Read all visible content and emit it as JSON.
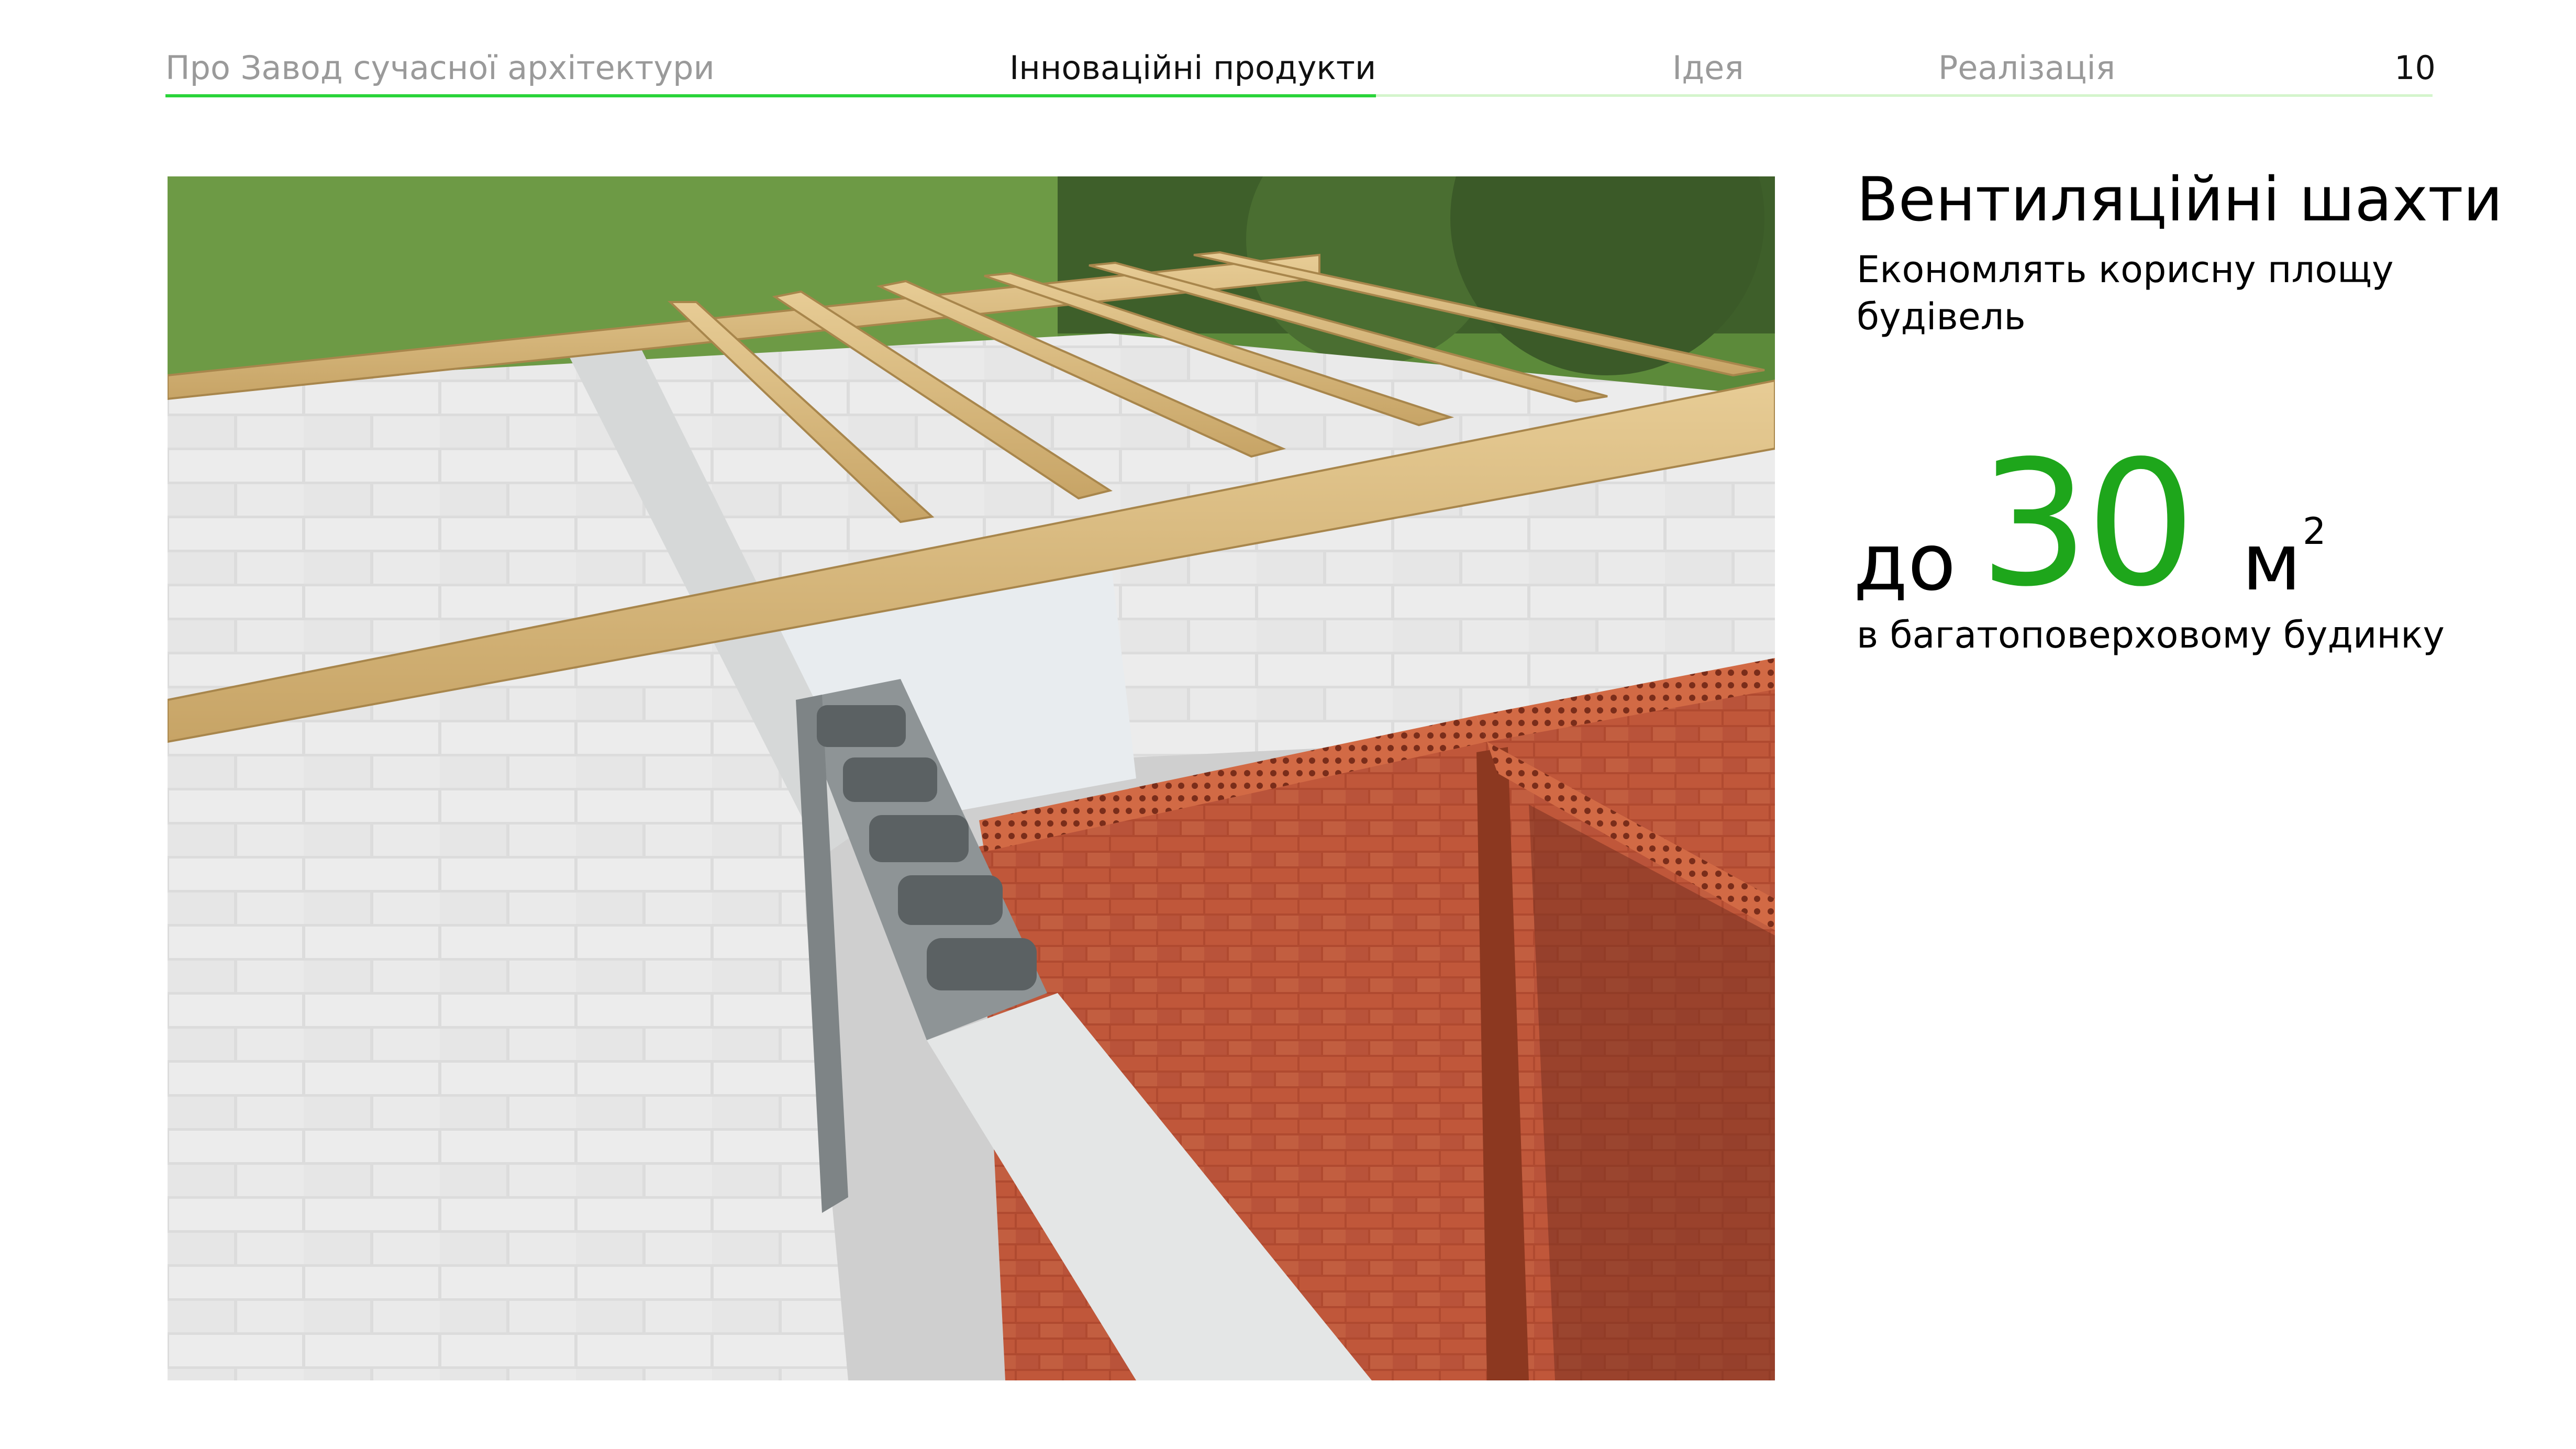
{
  "nav": {
    "items": [
      {
        "label": "Про Завод сучасної архітектури",
        "active": false
      },
      {
        "label": "Інноваційні продукти",
        "active": true
      },
      {
        "label": "Ідея",
        "active": false
      },
      {
        "label": "Реалізація",
        "active": false
      }
    ],
    "page_number": "10"
  },
  "photo": {
    "subject": "construction-site-photo"
  },
  "content": {
    "title": "Вентиляційні шахти",
    "subtitle": "Економлять корисну площу будівель",
    "stat_prefix": "до",
    "stat_value": "30",
    "stat_unit": "м",
    "stat_unit_sup": "2",
    "stat_caption": "в багатоповерховому будинку"
  },
  "colors": {
    "accent": "#1ea61b",
    "nav_active_line": "#2ad43a",
    "nav_inactive_text": "#9a9a9a"
  }
}
